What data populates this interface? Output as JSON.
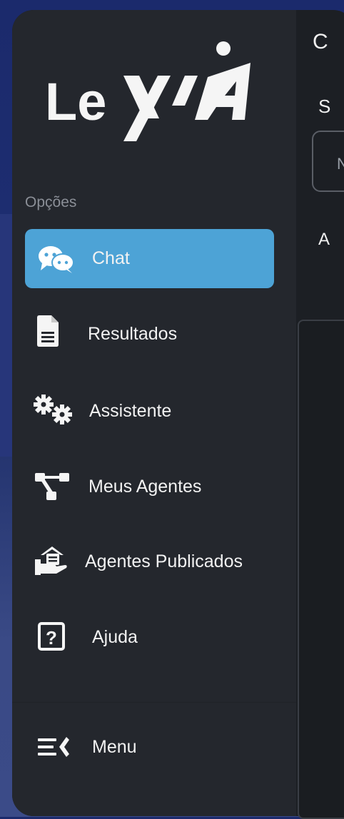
{
  "brand": {
    "logo_text": "LeXIA"
  },
  "sidebar": {
    "section_label": "Opções",
    "items": [
      {
        "label": "Chat",
        "icon": "chat-bubbles-icon",
        "active": true
      },
      {
        "label": "Resultados",
        "icon": "document-icon",
        "active": false
      },
      {
        "label": "Assistente",
        "icon": "gears-icon",
        "active": false
      },
      {
        "label": "Meus Agentes",
        "icon": "network-icon",
        "active": false
      },
      {
        "label": "Agentes Publicados",
        "icon": "publish-hand-icon",
        "active": false
      },
      {
        "label": "Ajuda",
        "icon": "help-icon",
        "active": false
      }
    ],
    "menu_label": "Menu"
  },
  "main": {
    "title": "C",
    "subtitle": "S",
    "input_value": "N",
    "label2": "A"
  },
  "colors": {
    "active_item": "#4da3d6",
    "sidebar_bg": "#24272d",
    "main_bg": "#1c1f24"
  }
}
